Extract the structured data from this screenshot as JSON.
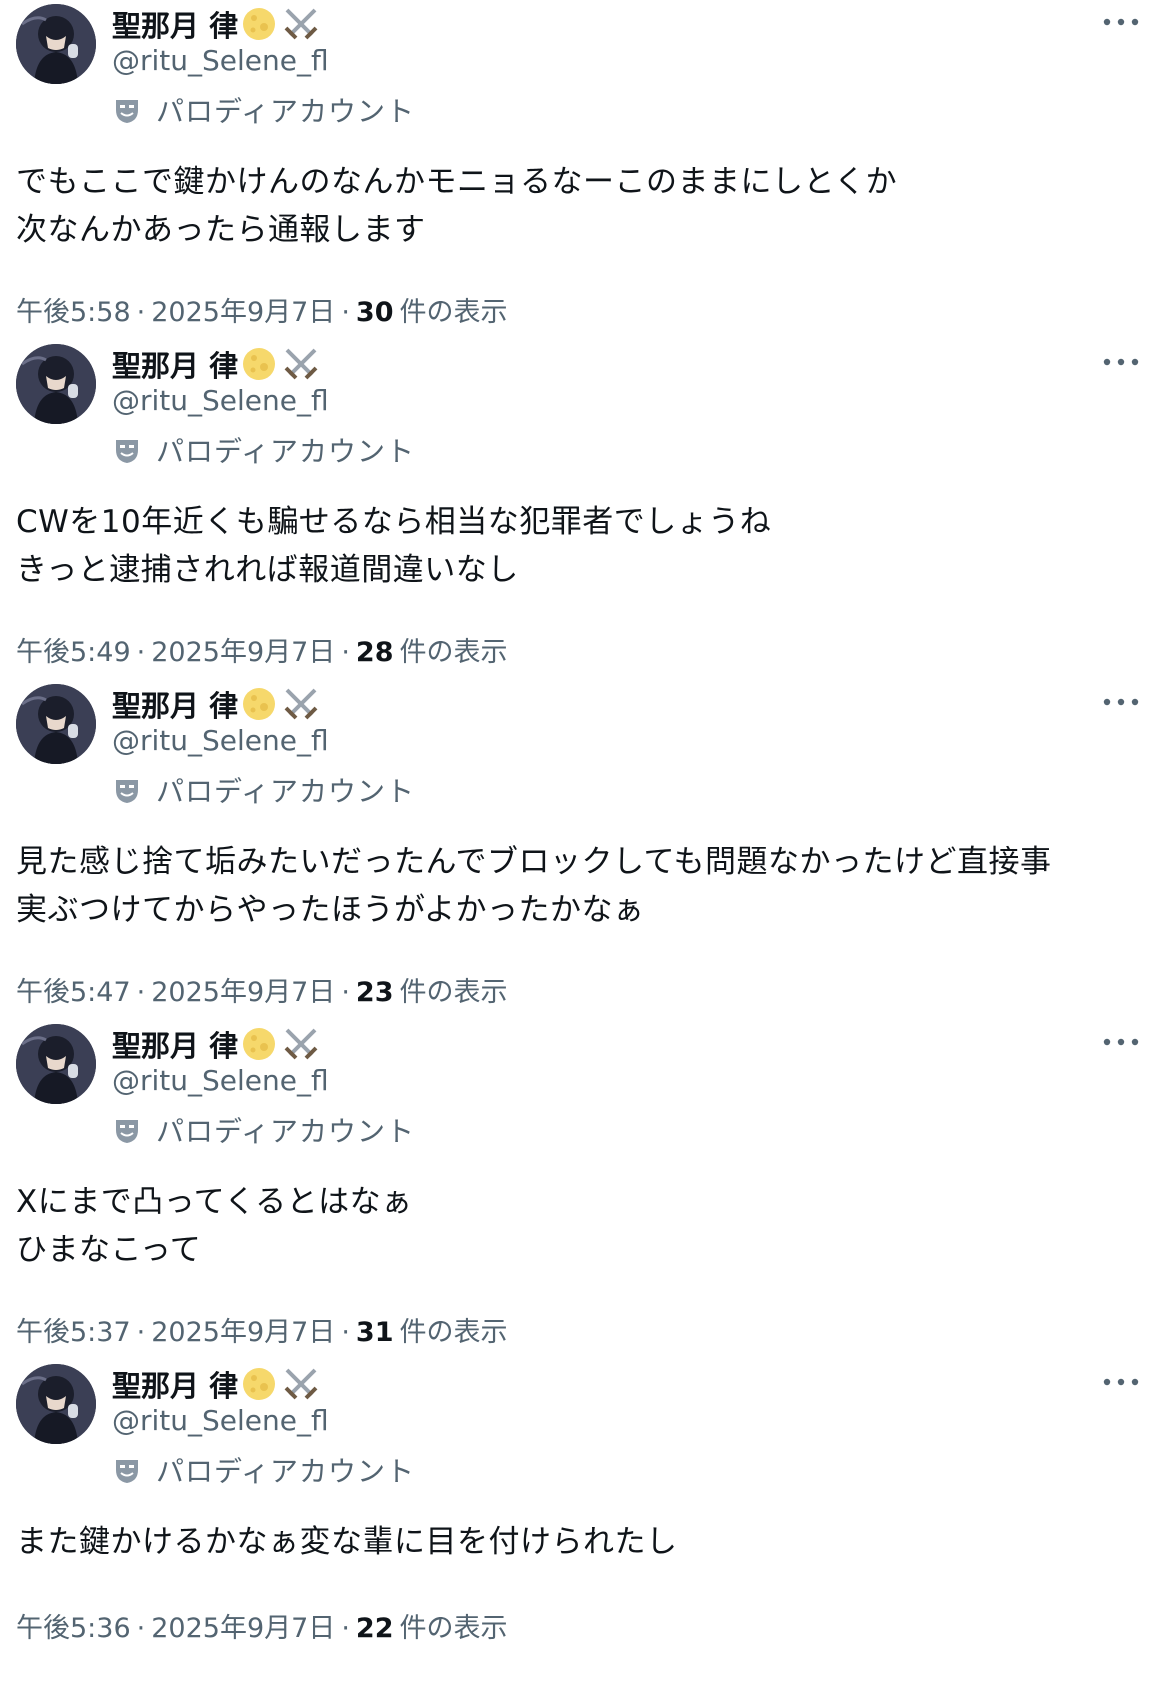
{
  "colors": {
    "primary_text": "#0f1419",
    "secondary_text": "#536471",
    "background": "#ffffff"
  },
  "tweets": [
    {
      "author": {
        "name": "聖那月 律",
        "handle": "@ritu_Selene_fl",
        "badges": [
          "moon-emoji",
          "crossed-swords-emoji"
        ],
        "label": "パロディアカウント"
      },
      "body": [
        "でもここで鍵かけんのなんかモニョるなーこのままにしとくか",
        "次なんかあったら通報します"
      ],
      "time": "午後5:58",
      "date": "2025年9月7日",
      "views": "30",
      "views_label": "件の表示",
      "dot": "·"
    },
    {
      "author": {
        "name": "聖那月 律",
        "handle": "@ritu_Selene_fl",
        "badges": [
          "moon-emoji",
          "crossed-swords-emoji"
        ],
        "label": "パロディアカウント"
      },
      "body": [
        "CWを10年近くも騙せるなら相当な犯罪者でしょうね",
        "きっと逮捕されれば報道間違いなし"
      ],
      "time": "午後5:49",
      "date": "2025年9月7日",
      "views": "28",
      "views_label": "件の表示",
      "dot": "·"
    },
    {
      "author": {
        "name": "聖那月 律",
        "handle": "@ritu_Selene_fl",
        "badges": [
          "moon-emoji",
          "crossed-swords-emoji"
        ],
        "label": "パロディアカウント"
      },
      "body": [
        "見た感じ捨て垢みたいだったんでブロックしても問題なかったけど直接事",
        "実ぶつけてからやったほうがよかったかなぁ"
      ],
      "time": "午後5:47",
      "date": "2025年9月7日",
      "views": "23",
      "views_label": "件の表示",
      "dot": "·"
    },
    {
      "author": {
        "name": "聖那月 律",
        "handle": "@ritu_Selene_fl",
        "badges": [
          "moon-emoji",
          "crossed-swords-emoji"
        ],
        "label": "パロディアカウント"
      },
      "body": [
        "Xにまで凸ってくるとはなぁ",
        "ひまなこって"
      ],
      "time": "午後5:37",
      "date": "2025年9月7日",
      "views": "31",
      "views_label": "件の表示",
      "dot": "·"
    },
    {
      "author": {
        "name": "聖那月 律",
        "handle": "@ritu_Selene_fl",
        "badges": [
          "moon-emoji",
          "crossed-swords-emoji"
        ],
        "label": "パロディアカウント"
      },
      "body": [
        "また鍵かけるかなぁ変な輩に目を付けられたし"
      ],
      "time": "午後5:36",
      "date": "2025年9月7日",
      "views": "22",
      "views_label": "件の表示",
      "dot": "·"
    }
  ]
}
